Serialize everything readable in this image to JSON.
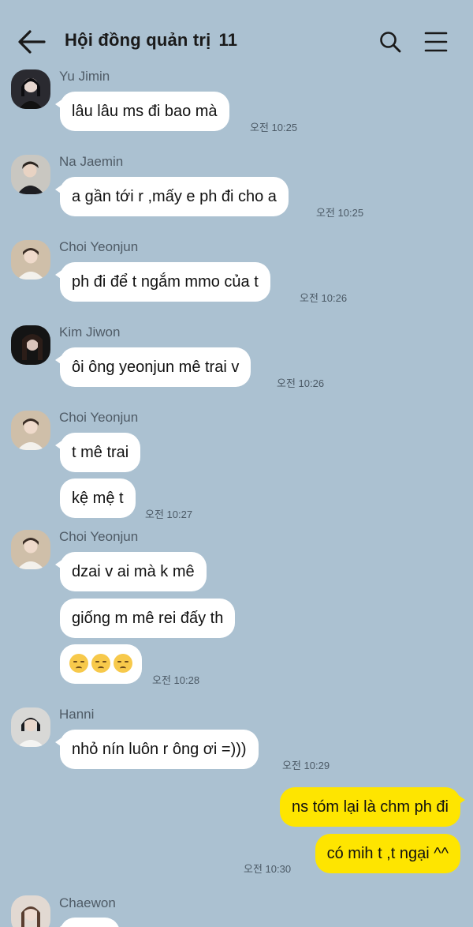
{
  "header": {
    "title": "Hội đồng quản trị",
    "member_count": "11",
    "back_icon": "arrow-left-icon",
    "search_icon": "search-icon",
    "menu_icon": "hamburger-menu-icon"
  },
  "messages": [
    {
      "sender": "Yu Jimin",
      "text": "lâu lâu ms đi bao mà",
      "time": "오전 10:25"
    },
    {
      "sender": "Na Jaemin",
      "text": "a gần tới r ,mấy e ph đi cho a",
      "time": "오전 10:25"
    },
    {
      "sender": "Choi Yeonjun",
      "text": "ph đi để t ngắm mmo của t",
      "time": "오전 10:26"
    },
    {
      "sender": "Kim Jiwon",
      "text": "ôi ông yeonjun mê trai v",
      "time": "오전 10:26"
    },
    {
      "sender": "Choi Yeonjun",
      "text": "t mê trai"
    },
    {
      "text": "kệ mệ t",
      "time": "오전 10:27"
    },
    {
      "sender": "Choi Yeonjun",
      "text": "dzai v ai mà k mê"
    },
    {
      "text": "giống m mê rei đấy th"
    },
    {
      "emoji": "pensive-face x3",
      "time": "오전 10:28"
    },
    {
      "sender": "Hanni",
      "text": "nhỏ nín luôn r ông ơi =)))",
      "time": "오전 10:29"
    },
    {
      "mine": true,
      "text": "ns tóm lại là chm ph đi"
    },
    {
      "mine": true,
      "text": "có mih t ,t ngại ^^",
      "time": "오전 10:30"
    },
    {
      "sender": "Chaewon",
      "text": ""
    }
  ],
  "colors": {
    "background": "#abc1d1",
    "incoming_bubble": "#ffffff",
    "outgoing_bubble": "#fee500"
  }
}
